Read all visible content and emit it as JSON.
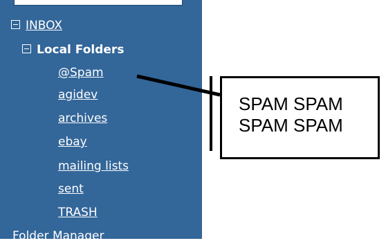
{
  "tree": {
    "inbox_label": "INBOX",
    "local_folders_label": "Local Folders",
    "folders": [
      "@Spam",
      "agidev",
      "archives",
      "ebay",
      "mailing lists",
      "sent",
      "TRASH"
    ],
    "folder_manager_label": "Folder Manager"
  },
  "callout": {
    "text": "SPAM SPAM\nSPAM SPAM"
  },
  "colors": {
    "sidebar_bg": "#336699",
    "text": "#ffffff",
    "callout_border": "#000000"
  }
}
